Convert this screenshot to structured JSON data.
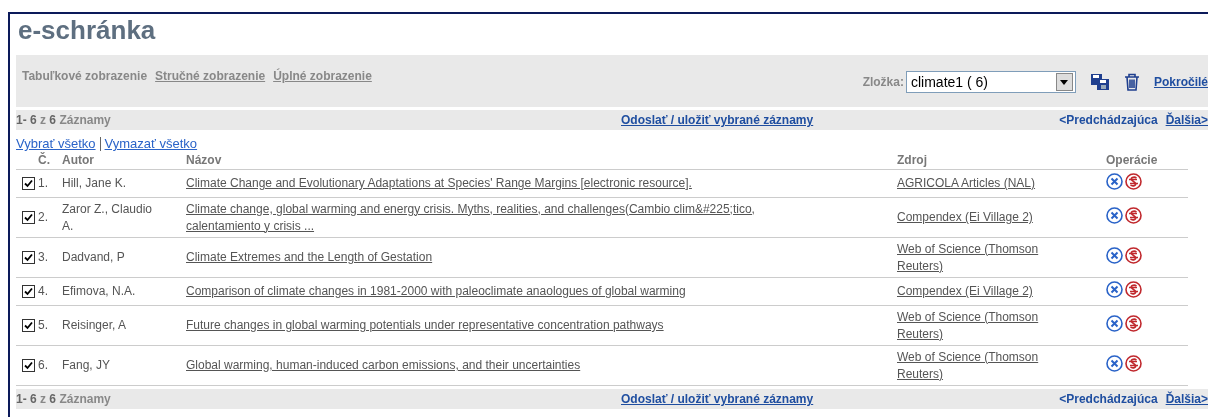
{
  "title": "e-schránka",
  "views": [
    {
      "label": "Tabuľkové zobrazenie",
      "selected": true
    },
    {
      "label": "Stručné zobrazenie",
      "selected": false
    },
    {
      "label": "Úplné zobrazenie",
      "selected": false
    }
  ],
  "folder": {
    "label": "Zložka:",
    "value": "climate1 ( 6)"
  },
  "advanced_link": "Pokročilé",
  "pager_top": {
    "count": "**1- 6** z **6** Záznamy",
    "send_link": "Odoslať / uložiť vybrané záznamy",
    "prev": "<Predchádzajúca",
    "next": "Ďalšia>"
  },
  "select_all": "Vybrať všetko",
  "clear_all": "Vymazať všetko",
  "columns": [
    "Č.",
    "Autor",
    "Názov",
    "Zdroj",
    "Operácie"
  ],
  "rows": [
    {
      "checked": true,
      "num": "1.",
      "author": "Hill, Jane K.",
      "title": "Climate Change and Evolutionary Adaptations at Species' Range Margins [electronic resource].",
      "source": "AGRICOLA Articles (NAL)"
    },
    {
      "checked": true,
      "num": "2.",
      "author": "Zaror Z., Claudio A.",
      "title": "Climate change, global warming and energy crisis. Myths, realities, and challenges(Cambio clim&#225;tico, calentamiento y crisis ...",
      "source": "Compendex (Ei Village 2)"
    },
    {
      "checked": true,
      "num": "3.",
      "author": "Dadvand, P",
      "title": "Climate Extremes and the Length of Gestation",
      "source": "Web of Science (Thomson Reuters)"
    },
    {
      "checked": true,
      "num": "4.",
      "author": "Efimova, N.A.",
      "title": "Comparison of climate changes in 1981-2000 with paleoclimate anaologues of global warming",
      "source": "Compendex (Ei Village 2)"
    },
    {
      "checked": true,
      "num": "5.",
      "author": "Reisinger, A",
      "title": "Future changes in global warming potentials under representative concentration pathways",
      "source": "Web of Science (Thomson Reuters)"
    },
    {
      "checked": true,
      "num": "6.",
      "author": "Fang, JY",
      "title": "Global warming, human-induced carbon emissions, and their uncertainties",
      "source": "Web of Science (Thomson Reuters)"
    }
  ],
  "pager_bottom": {
    "count": "**1- 6** z **6** Záznamy",
    "send_link": "Odoslať / uložiť vybrané záznamy",
    "prev": "<Predchádzajúca",
    "next": "Ďalšia>"
  }
}
